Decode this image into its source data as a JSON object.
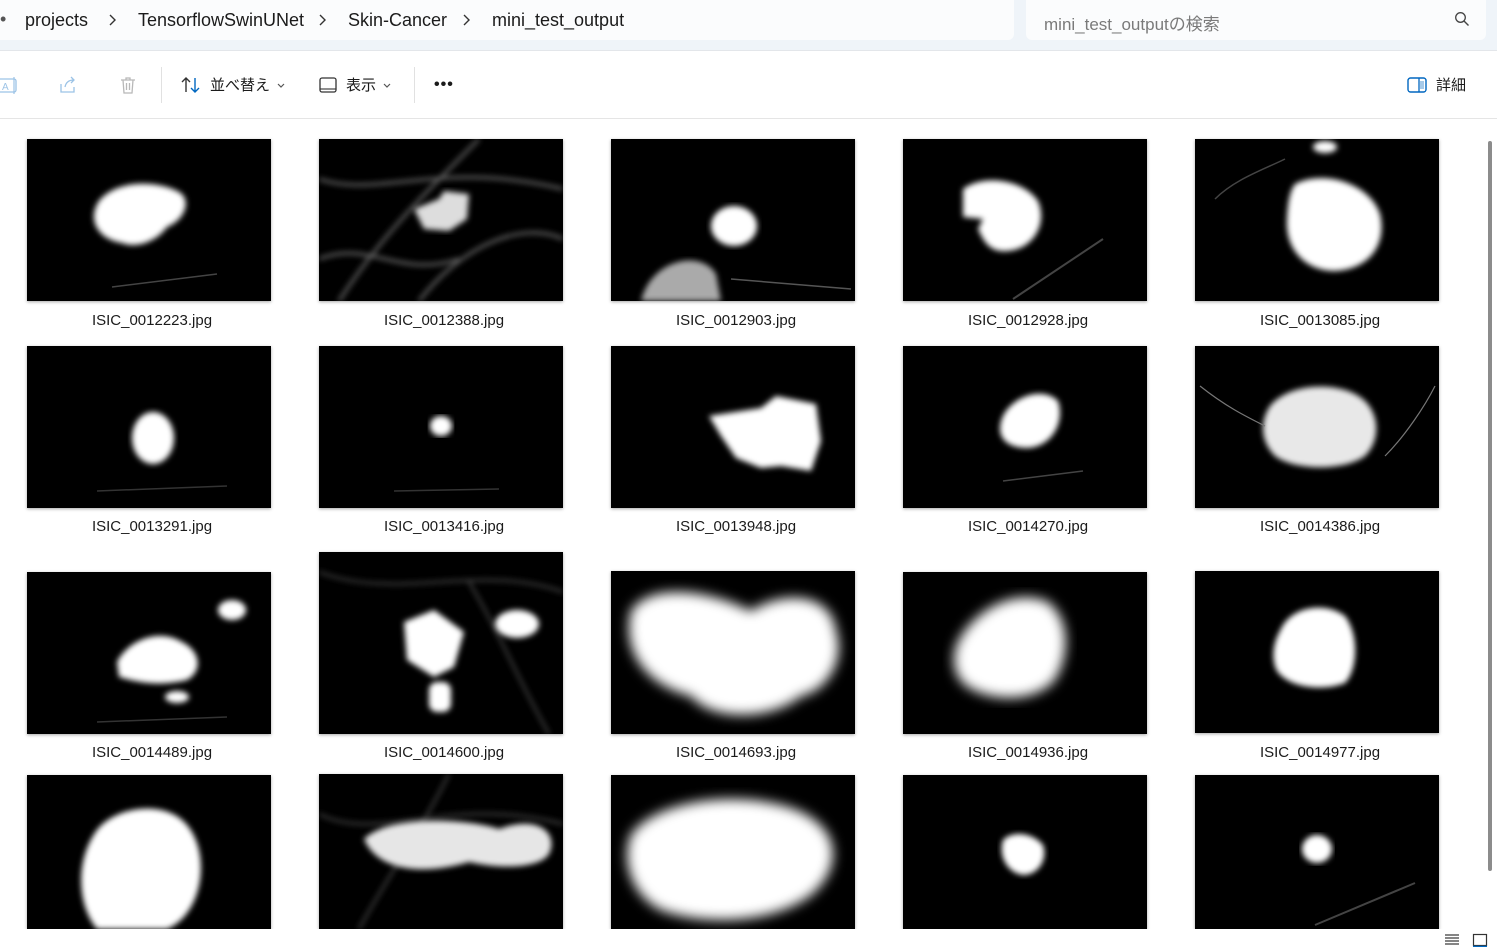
{
  "breadcrumb": {
    "items": [
      "projects",
      "TensorflowSwinUNet",
      "Skin-Cancer",
      "mini_test_output"
    ]
  },
  "search": {
    "placeholder": "mini_test_outputの検索"
  },
  "toolbar": {
    "rename_icon": "rename-icon",
    "share_icon": "share-icon",
    "delete_icon": "trash-icon",
    "sort_label": "並べ替え",
    "view_label": "表示",
    "more_label": "•••",
    "details_label": "詳細"
  },
  "files": [
    {
      "name": "ISIC_0012223.jpg"
    },
    {
      "name": "ISIC_0012388.jpg"
    },
    {
      "name": "ISIC_0012903.jpg"
    },
    {
      "name": "ISIC_0012928.jpg"
    },
    {
      "name": "ISIC_0013085.jpg"
    },
    {
      "name": "ISIC_0013291.jpg"
    },
    {
      "name": "ISIC_0013416.jpg"
    },
    {
      "name": "ISIC_0013948.jpg"
    },
    {
      "name": "ISIC_0014270.jpg"
    },
    {
      "name": "ISIC_0014386.jpg"
    },
    {
      "name": "ISIC_0014489.jpg"
    },
    {
      "name": "ISIC_0014600.jpg"
    },
    {
      "name": "ISIC_0014693.jpg"
    },
    {
      "name": "ISIC_0014936.jpg"
    },
    {
      "name": "ISIC_0014977.jpg"
    },
    {
      "name": ""
    },
    {
      "name": ""
    },
    {
      "name": ""
    },
    {
      "name": ""
    },
    {
      "name": ""
    }
  ],
  "colors": {
    "accent": "#0067c0",
    "address_bg": "#eff4f9"
  }
}
